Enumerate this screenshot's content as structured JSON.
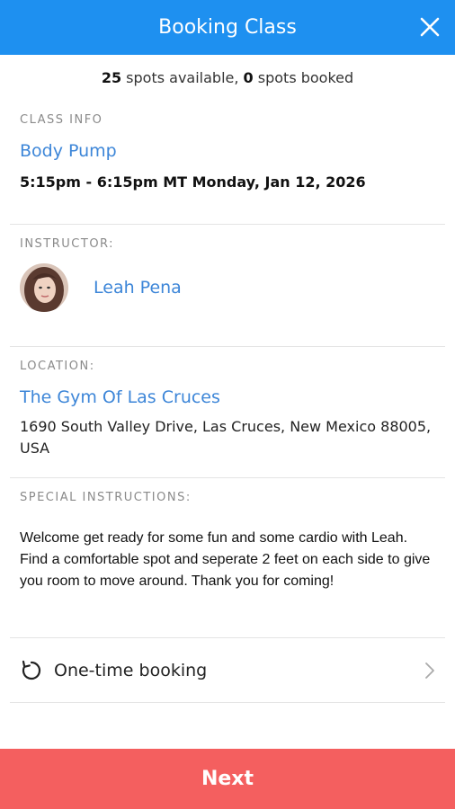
{
  "header": {
    "title": "Booking Class"
  },
  "spots": {
    "available_count": "25",
    "available_text": " spots available, ",
    "booked_count": "0",
    "booked_text": " spots booked"
  },
  "class_info": {
    "label": "CLASS INFO",
    "name": "Body Pump",
    "time": "5:15pm - 6:15pm MT Monday, Jan 12, 2026"
  },
  "instructor": {
    "label": "INSTRUCTOR:",
    "name": "Leah Pena"
  },
  "location": {
    "label": "LOCATION:",
    "name": "The Gym Of Las Cruces",
    "address": "1690 South Valley Drive, Las Cruces, New Mexico 88005, USA"
  },
  "special_instructions": {
    "label": "SPECIAL INSTRUCTIONS:",
    "text": "Welcome get ready for some fun and some cardio with Leah. Find a comfortable spot and seperate 2 feet on each side to give you room to move around. Thank you for coming!"
  },
  "booking": {
    "label": "One-time booking",
    "icon": "refresh-icon"
  },
  "footer": {
    "next_label": "Next"
  },
  "colors": {
    "header": "#1e90f0",
    "link": "#3d86d8",
    "next": "#f45f5f"
  }
}
